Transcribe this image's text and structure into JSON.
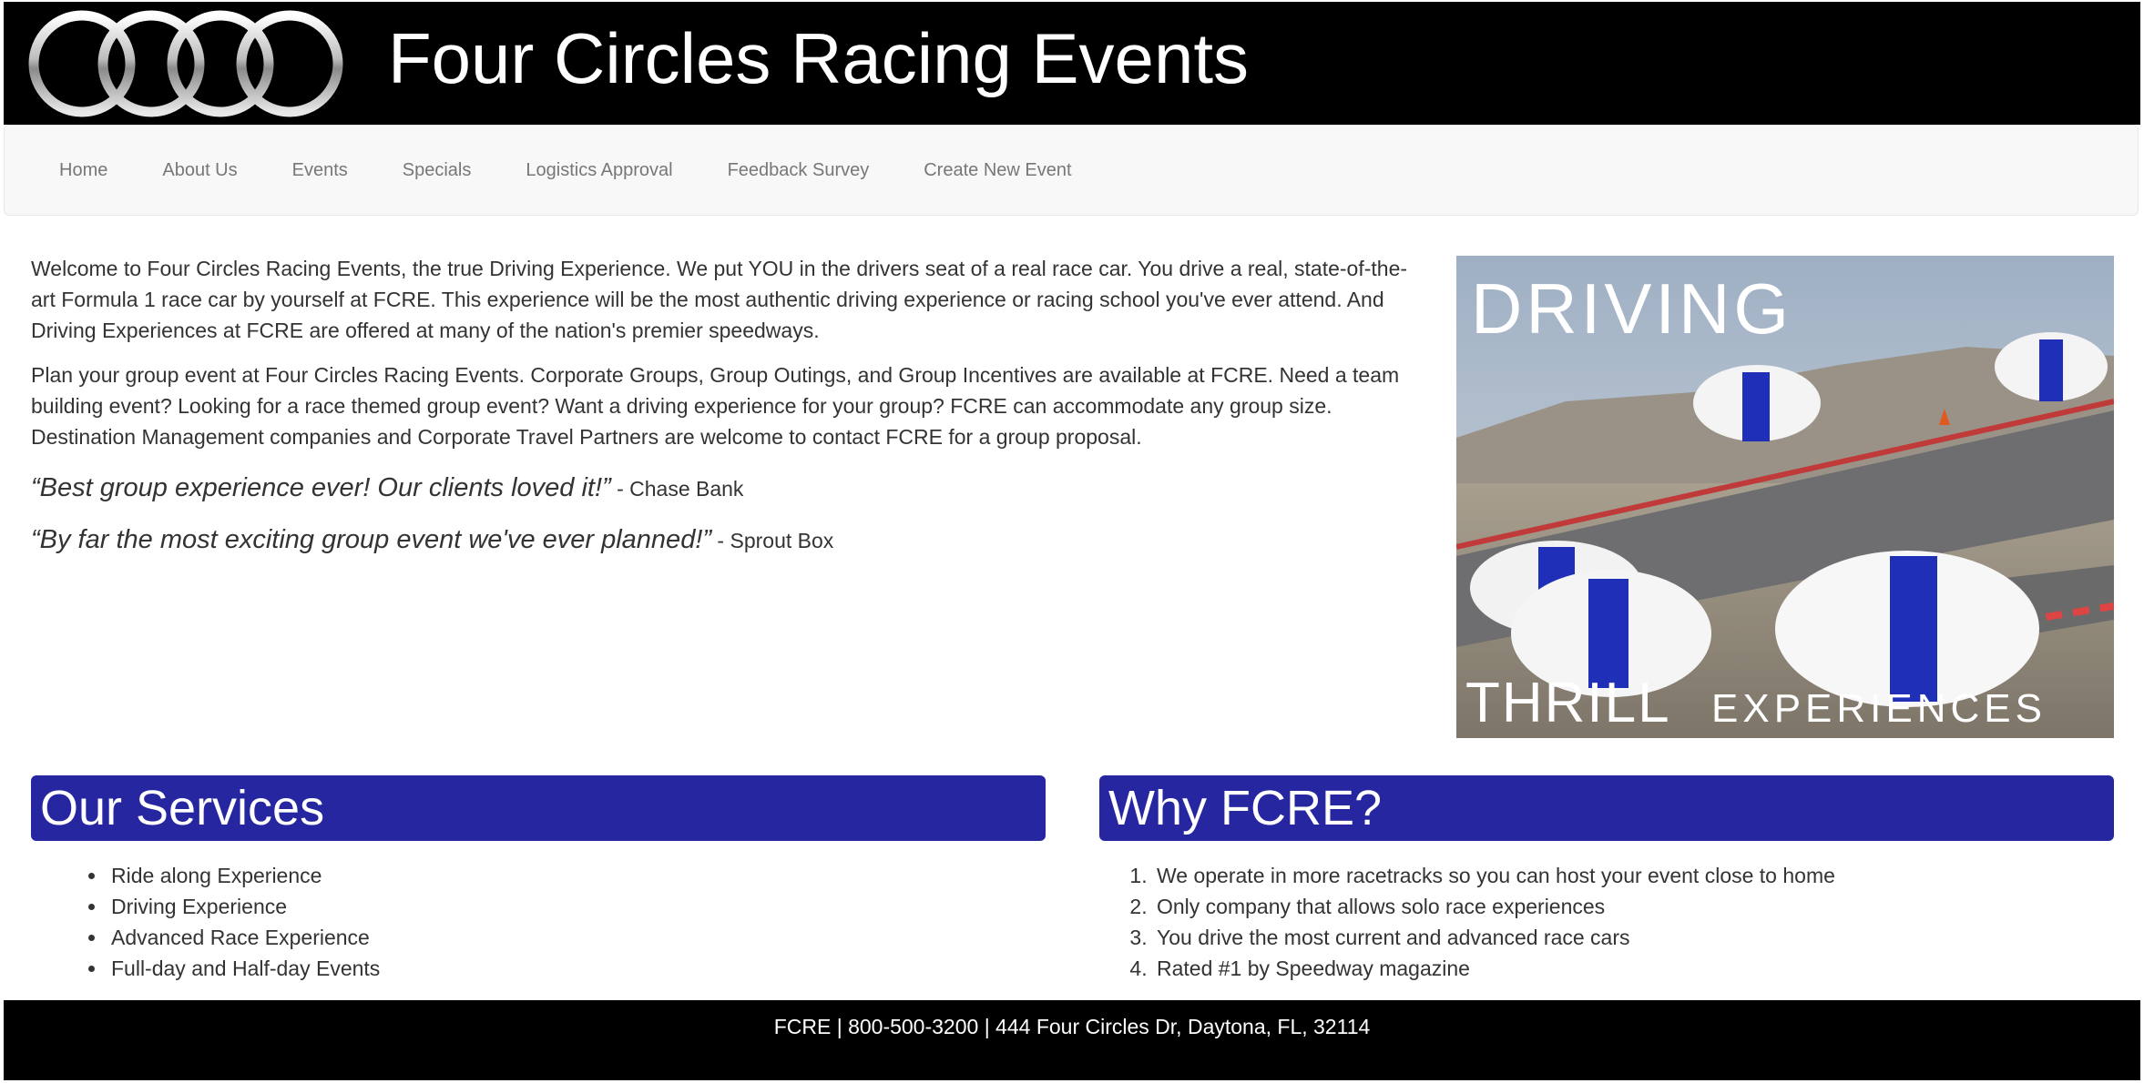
{
  "header": {
    "title": "Four Circles Racing Events",
    "logo_icon": "four-rings-logo"
  },
  "nav": {
    "items": [
      {
        "label": "Home"
      },
      {
        "label": "About Us"
      },
      {
        "label": "Events"
      },
      {
        "label": "Specials"
      },
      {
        "label": "Logistics Approval"
      },
      {
        "label": "Feedback Survey"
      },
      {
        "label": "Create New Event"
      }
    ]
  },
  "main": {
    "paragraphs": [
      "Welcome to Four Circles Racing Events, the true Driving Experience. We put YOU in the drivers seat of a real race car. You drive a real, state-of-the-art Formula 1 race car by yourself at FCRE. This experience will be the most authentic driving experience or racing school you've ever attend. And Driving Experiences at FCRE are offered at many of the nation's premier speedways.",
      "Plan your group event at Four Circles Racing Events. Corporate Groups, Group Outings, and Group Incentives are available at FCRE. Need a team building event? Looking for a race themed group event? Want a driving experience for your group? FCRE can accommodate any group size. Destination Management companies and Corporate Travel Partners are welcome to contact FCRE for a group proposal."
    ],
    "quotes": [
      {
        "text": "“Best group experience ever! Our clients loved it!”",
        "source": " - Chase Bank"
      },
      {
        "text": "“By far the most exciting group event we've ever planned!”",
        "source": " - Sprout Box"
      }
    ],
    "hero": {
      "line1": "DRIVING",
      "line2a": "THRILL",
      "line2b": "EXPERIENCES"
    }
  },
  "services": {
    "heading": "Our Services",
    "items": [
      "Ride along Experience",
      "Driving Experience",
      "Advanced Race Experience",
      "Full-day and Half-day Events"
    ]
  },
  "why": {
    "heading": "Why FCRE?",
    "items": [
      "We operate in more racetracks so you can host your event close to home",
      "Only company that allows solo race experiences",
      "You drive the most current and advanced race cars",
      "Rated #1 by Speedway magazine"
    ]
  },
  "footer": {
    "text": "FCRE | 800-500-3200 | 444 Four Circles Dr, Daytona, FL, 32114"
  },
  "colors": {
    "header_bg": "#000000",
    "panel_heading_bg": "#2626a0",
    "nav_bg": "#f8f8f8",
    "nav_text": "#777777",
    "body_text": "#333333"
  }
}
